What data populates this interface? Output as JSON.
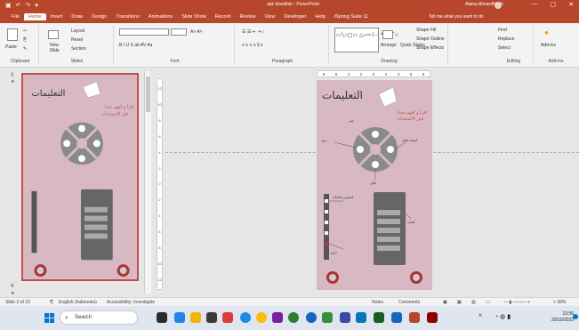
{
  "titlebar": {
    "autosave_icon": "save-icon",
    "document_title": "apk bismillah  -  PowerPoint",
    "user_name": "Alaina Almardhiyah",
    "minimize": "—",
    "restore": "▢",
    "close": "✕"
  },
  "menu": {
    "tabs": [
      "File",
      "Home",
      "Insert",
      "Draw",
      "Design",
      "Transitions",
      "Animations",
      "Slide Show",
      "Record",
      "Review",
      "View",
      "Developer",
      "Help",
      "iSpring Suite 11"
    ],
    "active": "Home",
    "tell_me": "Tell me what you want to do"
  },
  "ribbon": {
    "clipboard": {
      "paste": "Paste",
      "label": "Clipboard"
    },
    "slides": {
      "layout": "Layout",
      "reset": "Reset",
      "new_slide": "New Slide",
      "section": "Section",
      "label": "Slides"
    },
    "font": {
      "label": "Font",
      "size": "",
      "styles": "B  I  U  S  ab  AV  Aa"
    },
    "paragraph": {
      "label": "Paragraph"
    },
    "drawing": {
      "arrange": "Arrange",
      "quick_styles": "Quick Styles",
      "shape_fill": "Shape Fill",
      "shape_outline": "Shape Outline",
      "shape_effects": "Shape Effects",
      "label": "Drawing"
    },
    "editing": {
      "find": "Find",
      "replace": "Replace",
      "select": "Select",
      "label": "Editing"
    },
    "addins": {
      "add_ins": "Add-ins",
      "label": "Add-ins"
    }
  },
  "thumbnails": {
    "current_number": "3",
    "next_number": "4"
  },
  "ruler_h": [
    "8",
    "6",
    "4",
    "2",
    "0",
    "2",
    "4",
    "6",
    "8"
  ],
  "ruler_v": [
    "12",
    "10",
    "8",
    "6",
    "4",
    "2",
    "0",
    "2",
    "4",
    "6",
    "8",
    "10",
    "12"
  ],
  "slide": {
    "title": "التعليمات",
    "subtitle_line1": "اقرأ و افهم جيدا",
    "subtitle_line2": "قبل الاستخدام",
    "label_top": "تكبير",
    "label_left": "ترجع",
    "label_right": "الصفحة التالية",
    "label_bottom": "التالي",
    "label_menu": "المحتوى و الأهداف",
    "label_list": "القائمة",
    "label_exit": "خروج",
    "menu_items": [
      "",
      "",
      "",
      "",
      ""
    ],
    "panel_right_label": "معلومات",
    "panel_bottom_label": "دليل الإستخدام"
  },
  "statusbar": {
    "slide_of": "Slide 3 of 10",
    "language": "English (Indonesia)",
    "accessibility": "Accessibility: Investigate",
    "notes": "Notes",
    "comments": "Comments",
    "zoom": "+ 38%"
  },
  "taskbar": {
    "search": "Search",
    "time": "13:56",
    "date": "20/10/2023"
  },
  "colors": {
    "accent": "#b7472a",
    "slide_bg": "#d8b9c3",
    "title_red": "#c0504d"
  }
}
